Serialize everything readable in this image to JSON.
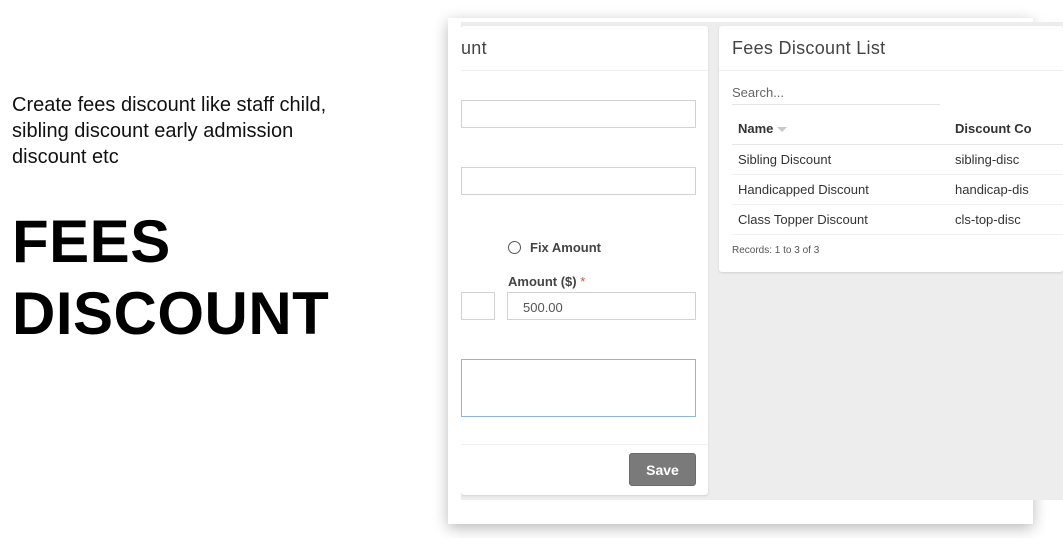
{
  "intro": {
    "description": "Create fees discount like staff child, sibling discount early admission discount etc",
    "headline_line1": "FEES",
    "headline_line2": "DISCOUNT"
  },
  "form_panel": {
    "title": "unt",
    "radio_option_label": "Fix Amount",
    "amount_label": "Amount ($)",
    "required_mark": "*",
    "amount_value": "500.00",
    "save_label": "Save"
  },
  "list_panel": {
    "title": "Fees Discount List",
    "search_placeholder": "Search...",
    "columns": [
      "Name",
      "Discount Co"
    ],
    "rows": [
      {
        "name": "Sibling Discount",
        "code": "sibling-disc"
      },
      {
        "name": "Handicapped Discount",
        "code": "handicap-dis"
      },
      {
        "name": "Class Topper Discount",
        "code": "cls-top-disc"
      }
    ],
    "records_text": "Records: 1 to 3 of 3"
  },
  "icons": {
    "sort": "sort-down-icon",
    "radio": "radio-unchecked-icon"
  },
  "colors": {
    "save_button": "#7a7a7a",
    "required": "#dd4b39",
    "active_input_border": "#8fb3d9"
  }
}
